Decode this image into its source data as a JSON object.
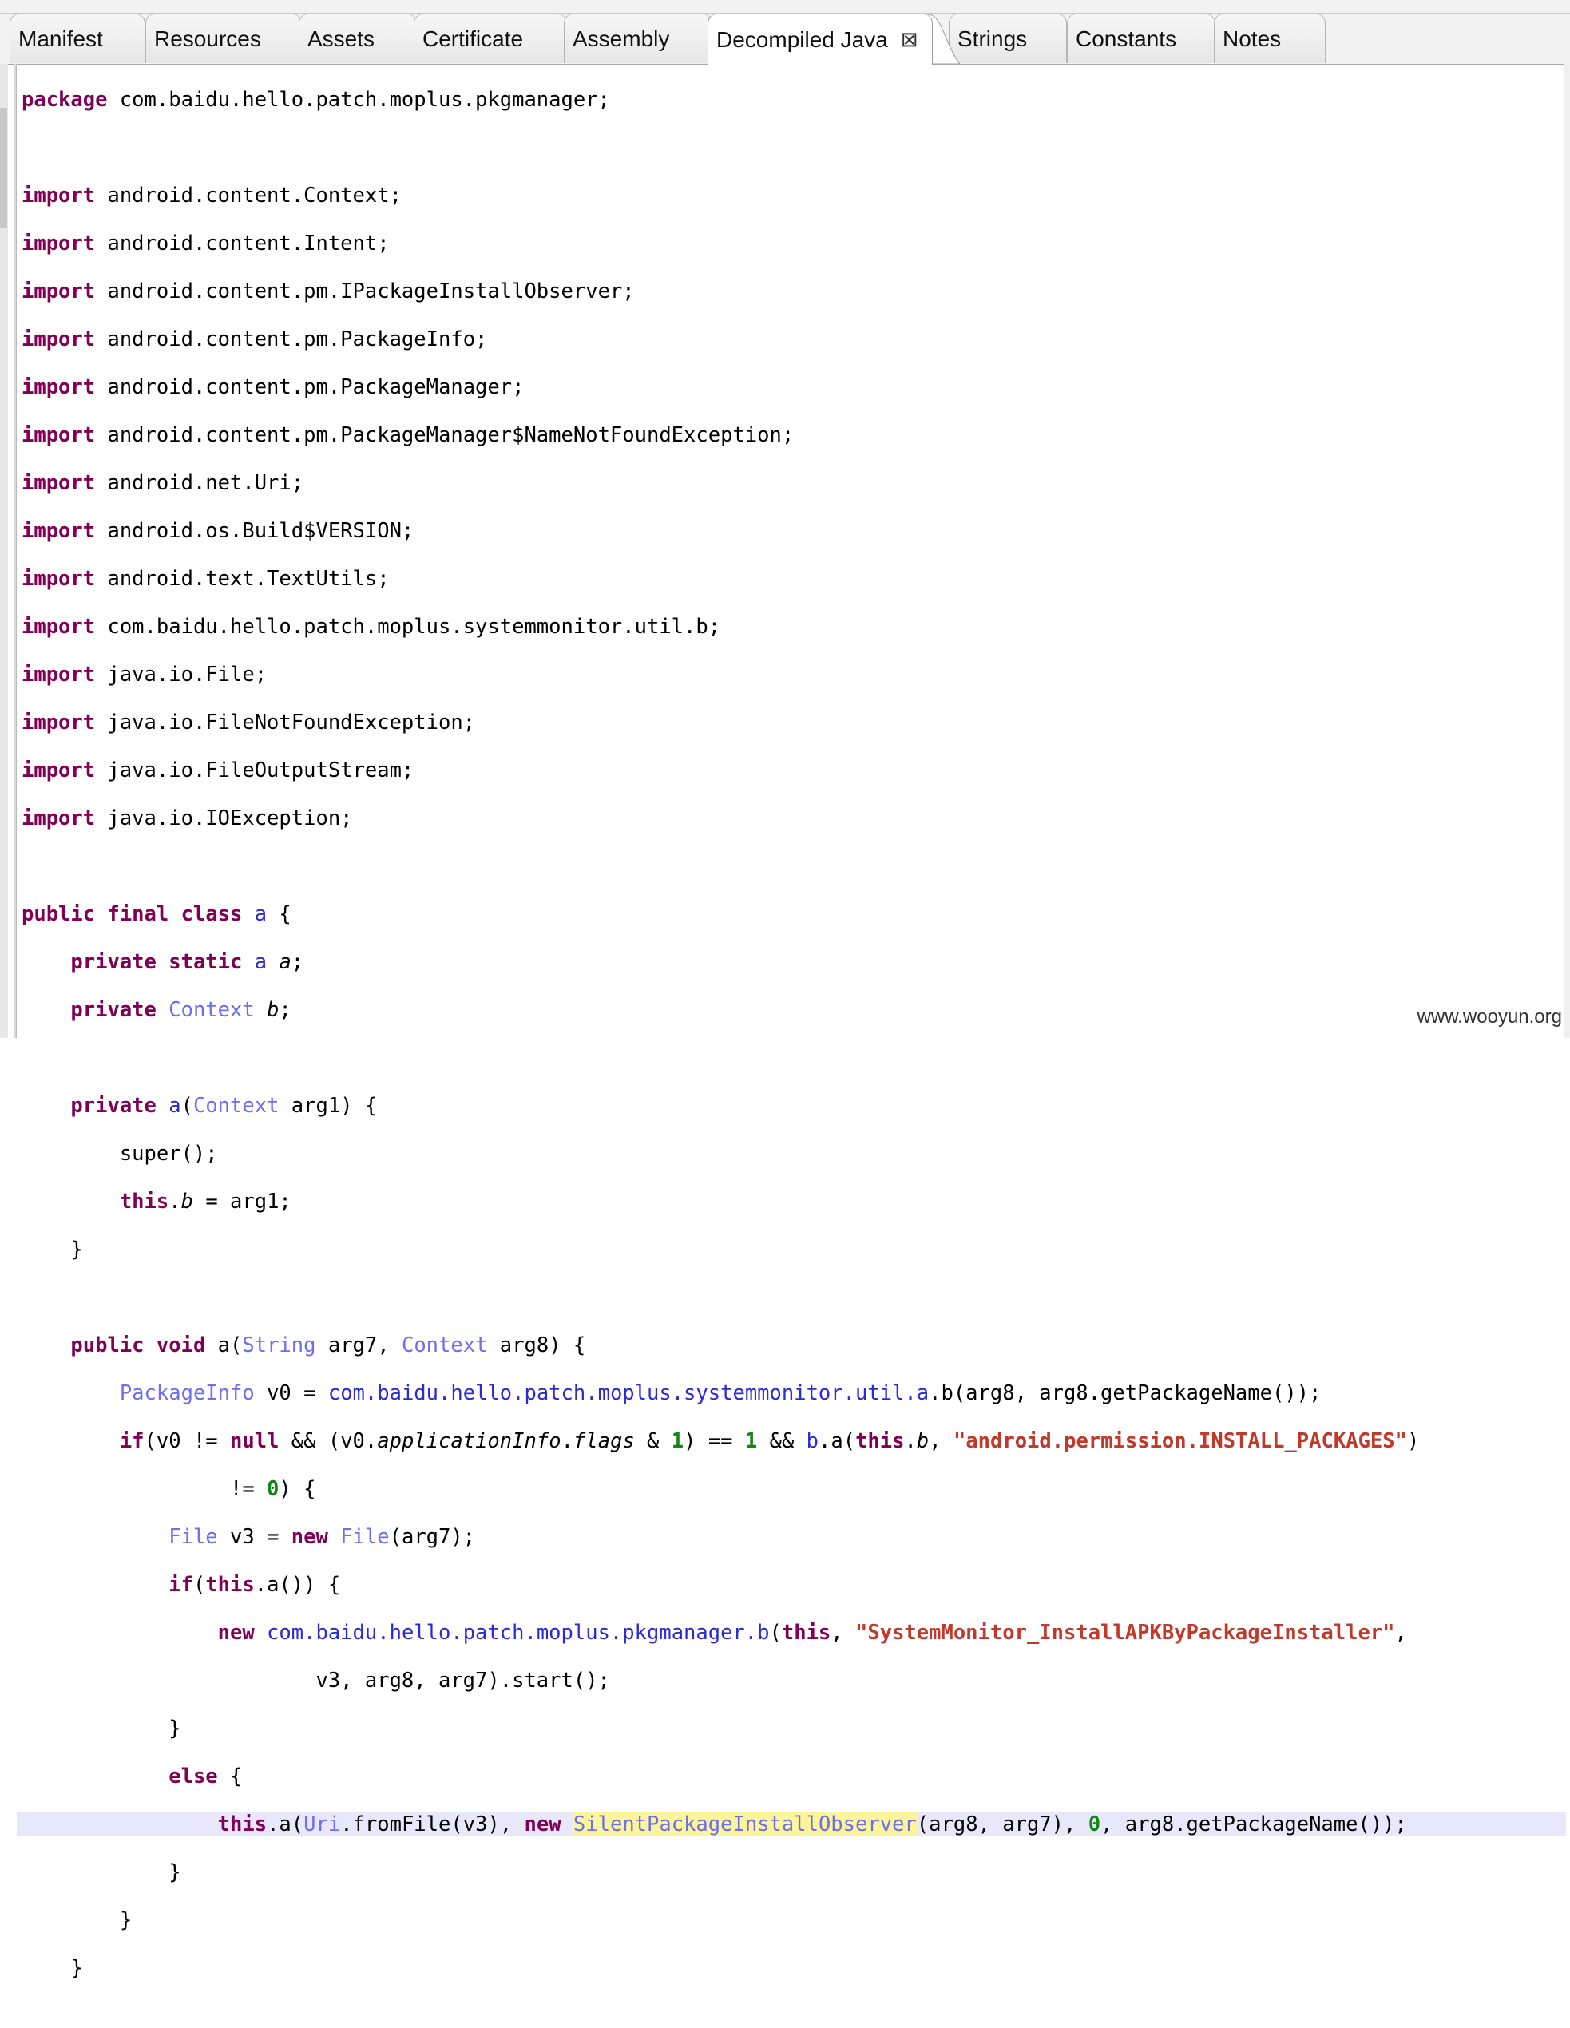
{
  "tabs": [
    {
      "label": "Manifest",
      "active": false
    },
    {
      "label": "Resources",
      "active": false
    },
    {
      "label": "Assets",
      "active": false
    },
    {
      "label": "Certificate",
      "active": false
    },
    {
      "label": "Assembly",
      "active": false
    },
    {
      "label": "Decompiled Java",
      "active": true,
      "close": "⊠"
    },
    {
      "label": "Strings",
      "active": false
    },
    {
      "label": "Constants",
      "active": false
    },
    {
      "label": "Notes",
      "active": false
    }
  ],
  "code": {
    "package_kw": "package",
    "package_name": " com.baidu.hello.patch.moplus.pkgmanager;",
    "import_kw": "import",
    "imports": [
      " android.content.Context;",
      " android.content.Intent;",
      " android.content.pm.IPackageInstallObserver;",
      " android.content.pm.PackageInfo;",
      " android.content.pm.PackageManager;",
      " android.content.pm.PackageManager$NameNotFoundException;",
      " android.net.Uri;",
      " android.os.Build$VERSION;",
      " android.text.TextUtils;",
      " com.baidu.hello.patch.moplus.systemmonitor.util.b;",
      " java.io.File;",
      " java.io.FileNotFoundException;",
      " java.io.FileOutputStream;",
      " java.io.IOException;"
    ],
    "s_install_perm": "\"android.permission.INSTALL_PACKAGES\"",
    "s_thread_name": "\"SystemMonitor_InstallAPKByPackageInstaller\"",
    "observer_class": "SilentPackageInstallObserver"
  },
  "watermark": "www.wooyun.org"
}
